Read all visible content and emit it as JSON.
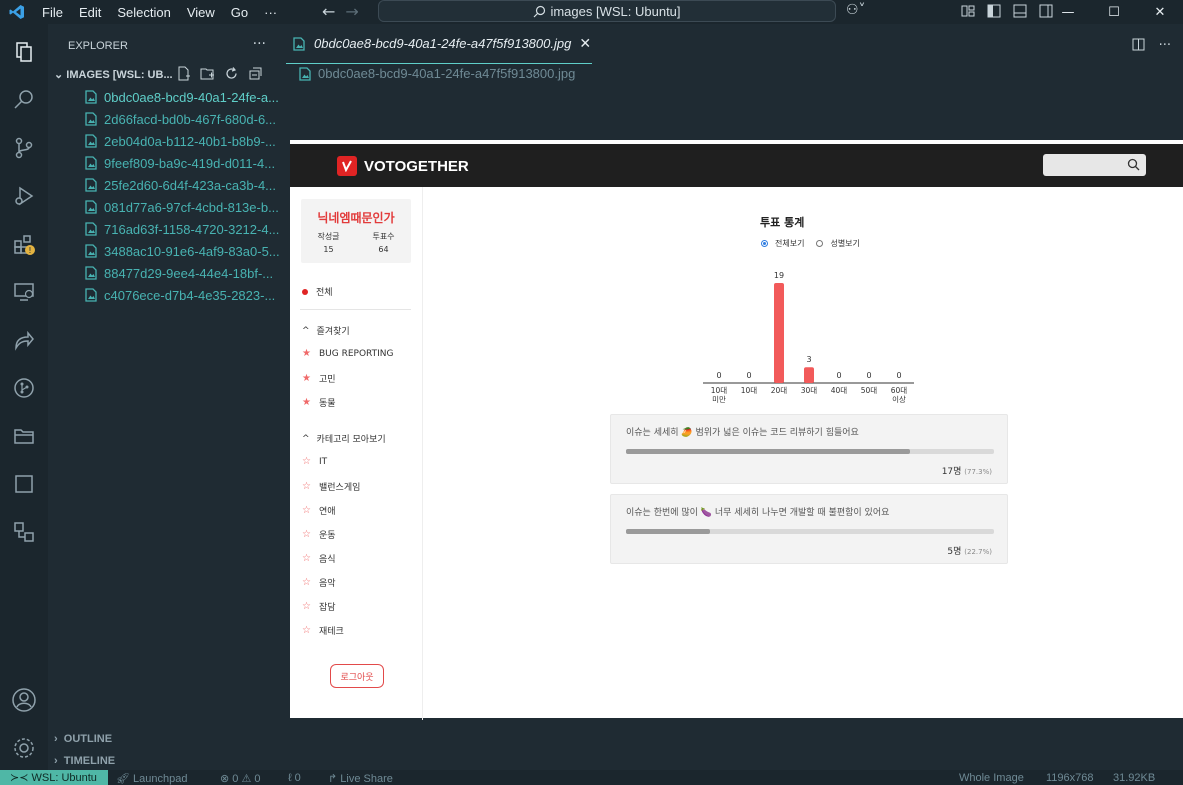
{
  "window": {
    "title": "images [WSL: Ubuntu]",
    "menu": [
      "File",
      "Edit",
      "Selection",
      "View",
      "Go",
      "···"
    ]
  },
  "explorer": {
    "title": "EXPLORER",
    "more": "···",
    "folder": "IMAGES [WSL: UB...",
    "files": [
      "0bdc0ae8-bcd9-40a1-24fe-a...",
      "2d66facd-bd0b-467f-680d-6...",
      "2eb04d0a-b112-40b1-b8b9-...",
      "9feef809-ba9c-419d-d011-4...",
      "25fe2d60-6d4f-423a-ca3b-4...",
      "081d77a6-97cf-4cbd-813e-b...",
      "716ad63f-1158-4720-3212-4...",
      "3488ac10-91e6-4af9-83a0-5...",
      "88477d29-9ee4-44e4-18bf-...",
      "c4076ece-d7b4-4e35-2823-..."
    ],
    "outline": "OUTLINE",
    "timeline": "TIMELINE"
  },
  "editor": {
    "tab_label": "0bdc0ae8-bcd9-40a1-24fe-a47f5f913800.jpg",
    "breadcrumb": "0bdc0ae8-bcd9-40a1-24fe-a47f5f913800.jpg"
  },
  "app": {
    "brand": "VOTOGETHER",
    "profile": {
      "name": "닉네엠때문인가",
      "posts_label": "작성글",
      "posts": "15",
      "votes_label": "투표수",
      "votes": "64"
    },
    "all_label": "전체",
    "favorites_label": "즐겨찾기",
    "favorites": [
      "BUG REPORTING",
      "고민",
      "동물"
    ],
    "categories_label": "카테고리 모아보기",
    "categories": [
      "IT",
      "밸런스게임",
      "연애",
      "운동",
      "음식",
      "음악",
      "잡담",
      "재테크"
    ],
    "logout_label": "로그아웃",
    "stats_title": "투표 통계",
    "radio_all": "전체보기",
    "radio_gender": "성별보기",
    "options": [
      {
        "text": "이슈는 세세히 🥭 범위가 넓은 이슈는 코드 리뷰하기 힘들어요",
        "count": "17명",
        "percent": "(77.3%)",
        "ratio": 0.773
      },
      {
        "text": "이슈는 한번에 많이 🍆 너무 세세히 나누면 개발할 때 불편함이 있어요",
        "count": "5명",
        "percent": "(22.7%)",
        "ratio": 0.227
      }
    ]
  },
  "chart_data": {
    "type": "bar",
    "categories": [
      "10대 미만",
      "10대",
      "20대",
      "30대",
      "40대",
      "50대",
      "60대 이상"
    ],
    "values": [
      0,
      0,
      19,
      3,
      0,
      0,
      0
    ],
    "bar_color": "#f25a5a"
  },
  "statusbar": {
    "remote": "WSL: Ubuntu",
    "launchpad": "Launchpad",
    "problems": "⊗ 0  ⚠ 0",
    "ports": "0",
    "liveshare": "Live Share",
    "image_mode": "Whole Image",
    "dimensions": "1196x768",
    "filesize": "31.92KB"
  },
  "colors": {
    "accent": "#5fcfc9",
    "brand_red": "#e02424"
  }
}
